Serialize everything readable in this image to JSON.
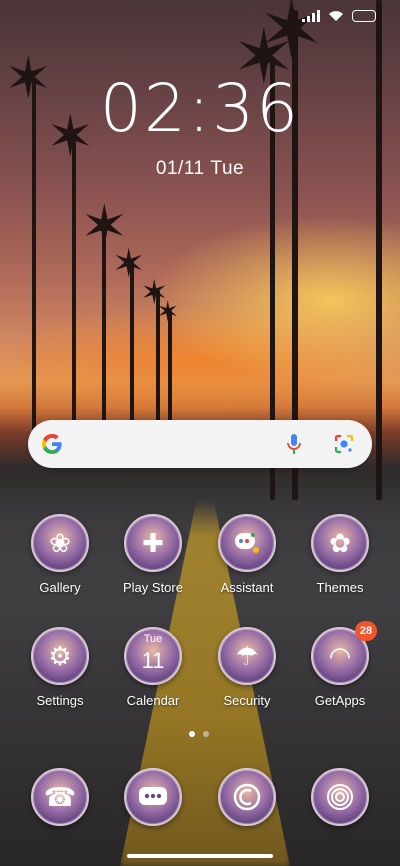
{
  "status_bar": {
    "signal_icon": "cell-signal-icon",
    "wifi_icon": "wifi-icon",
    "battery_icon": "battery-icon"
  },
  "clock": {
    "time": "02:36",
    "date": "01/11",
    "weekday": "Tue"
  },
  "search_widget": {
    "logo_icon": "google-g-icon",
    "mic_icon": "voice-search-icon",
    "lens_icon": "google-lens-icon"
  },
  "apps": [
    {
      "label": "Gallery",
      "icon": "gallery-icon"
    },
    {
      "label": "Play Store",
      "icon": "puzzle-icon"
    },
    {
      "label": "Assistant",
      "icon": "assistant-icon"
    },
    {
      "label": "Themes",
      "icon": "flower-icon"
    },
    {
      "label": "Settings",
      "icon": "gears-icon"
    },
    {
      "label": "Calendar",
      "icon": "calendar-icon",
      "weekday": "Tue",
      "day": "11"
    },
    {
      "label": "Security",
      "icon": "umbrella-icon"
    },
    {
      "label": "GetApps",
      "icon": "getapps-icon",
      "badge": "28"
    }
  ],
  "page_indicator": {
    "count": 2,
    "active": 1
  },
  "dock": [
    {
      "icon": "phone-icon"
    },
    {
      "icon": "messages-icon"
    },
    {
      "icon": "browser-icon"
    },
    {
      "icon": "camera-icon"
    }
  ],
  "colors": {
    "badge": "#f2542d",
    "ring_border": "#d9c7d6"
  }
}
